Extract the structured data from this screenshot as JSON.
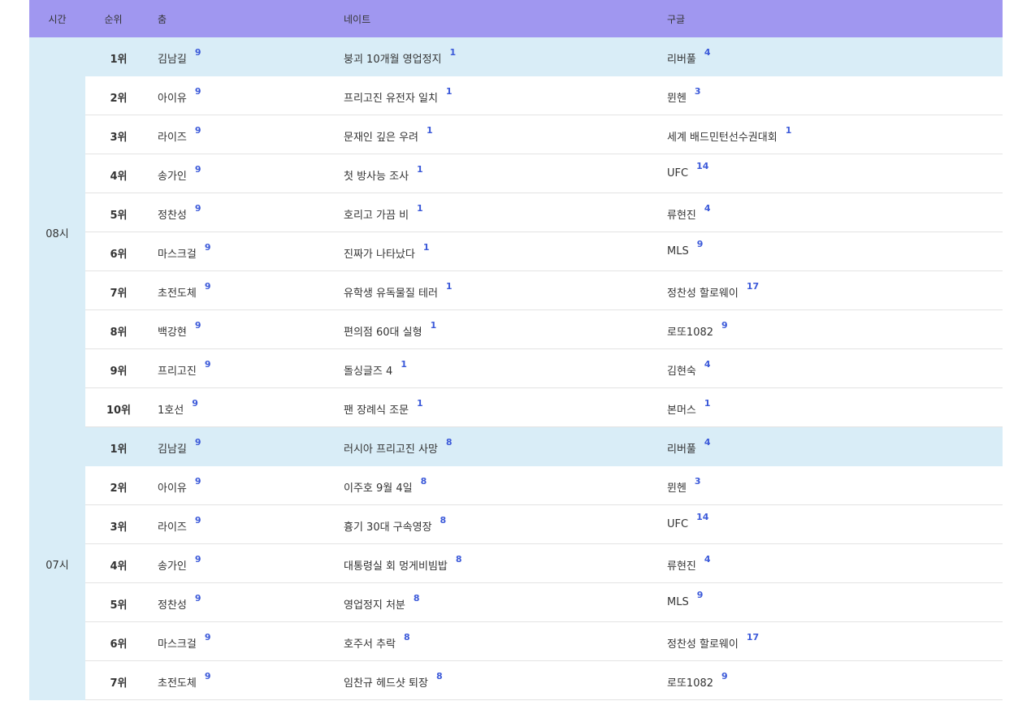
{
  "headers": {
    "time": "시간",
    "rank": "순위",
    "col_a": "춤",
    "col_b": "네이트",
    "col_c": "구글"
  },
  "groups": [
    {
      "time": "08시",
      "rows": [
        {
          "rank": "1위",
          "a": "김남길",
          "a_n": "9",
          "b": "붕괴 10개월 영업정지",
          "b_n": "1",
          "c": "리버풀",
          "c_n": "4"
        },
        {
          "rank": "2위",
          "a": "아이유",
          "a_n": "9",
          "b": "프리고진 유전자 일치",
          "b_n": "1",
          "c": "뮌헨",
          "c_n": "3"
        },
        {
          "rank": "3위",
          "a": "라이즈",
          "a_n": "9",
          "b": "문재인 깊은 우려",
          "b_n": "1",
          "c": "세계 배드민턴선수권대회",
          "c_n": "1"
        },
        {
          "rank": "4위",
          "a": "송가인",
          "a_n": "9",
          "b": "첫 방사능 조사",
          "b_n": "1",
          "c": "UFC",
          "c_n": "14"
        },
        {
          "rank": "5위",
          "a": "정찬성",
          "a_n": "9",
          "b": "호리고 가끔 비",
          "b_n": "1",
          "c": "류현진",
          "c_n": "4"
        },
        {
          "rank": "6위",
          "a": "마스크걸",
          "a_n": "9",
          "b": "진짜가 나타났다",
          "b_n": "1",
          "c": "MLS",
          "c_n": "9"
        },
        {
          "rank": "7위",
          "a": "초전도체",
          "a_n": "9",
          "b": "유학생 유독물질 테러",
          "b_n": "1",
          "c": "정찬성 할로웨이",
          "c_n": "17"
        },
        {
          "rank": "8위",
          "a": "백강현",
          "a_n": "9",
          "b": "편의점 60대 실형",
          "b_n": "1",
          "c": "로또1082",
          "c_n": "9"
        },
        {
          "rank": "9위",
          "a": "프리고진",
          "a_n": "9",
          "b": "돌싱글즈 4",
          "b_n": "1",
          "c": "김현숙",
          "c_n": "4"
        },
        {
          "rank": "10위",
          "a": "1호선",
          "a_n": "9",
          "b": "팬 장례식 조문",
          "b_n": "1",
          "c": "본머스",
          "c_n": "1"
        }
      ]
    },
    {
      "time": "07시",
      "rows": [
        {
          "rank": "1위",
          "a": "김남길",
          "a_n": "9",
          "b": "러시아 프리고진 사망",
          "b_n": "8",
          "c": "리버풀",
          "c_n": "4"
        },
        {
          "rank": "2위",
          "a": "아이유",
          "a_n": "9",
          "b": "이주호 9월 4일",
          "b_n": "8",
          "c": "뮌헨",
          "c_n": "3"
        },
        {
          "rank": "3위",
          "a": "라이즈",
          "a_n": "9",
          "b": "흉기 30대 구속영장",
          "b_n": "8",
          "c": "UFC",
          "c_n": "14"
        },
        {
          "rank": "4위",
          "a": "송가인",
          "a_n": "9",
          "b": "대통령실 회 멍게비빔밥",
          "b_n": "8",
          "c": "류현진",
          "c_n": "4"
        },
        {
          "rank": "5위",
          "a": "정찬성",
          "a_n": "9",
          "b": "영업정지 처분",
          "b_n": "8",
          "c": "MLS",
          "c_n": "9"
        },
        {
          "rank": "6위",
          "a": "마스크걸",
          "a_n": "9",
          "b": "호주서 추락",
          "b_n": "8",
          "c": "정찬성 할로웨이",
          "c_n": "17"
        },
        {
          "rank": "7위",
          "a": "초전도체",
          "a_n": "9",
          "b": "임찬규 헤드샷 퇴장",
          "b_n": "8",
          "c": "로또1082",
          "c_n": "9"
        }
      ]
    }
  ]
}
